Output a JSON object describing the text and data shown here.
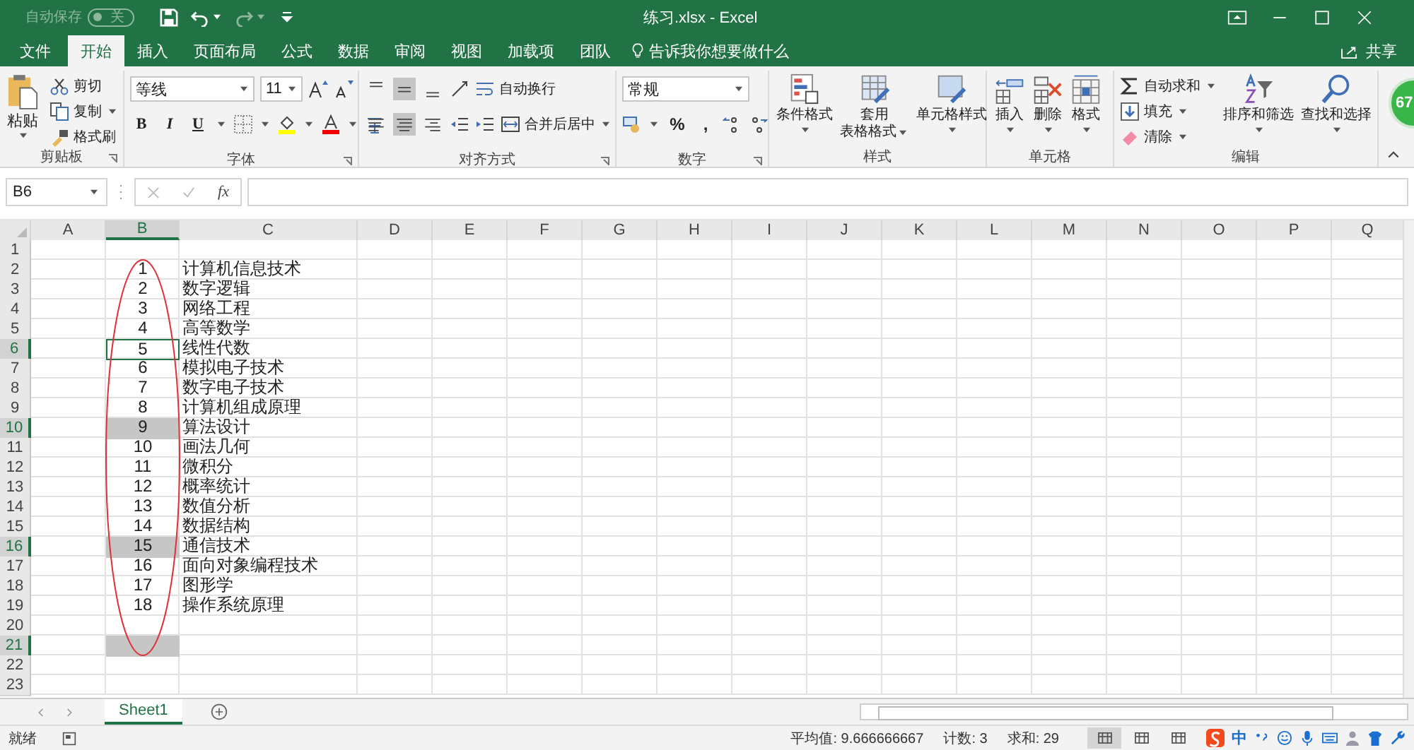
{
  "title_bar": {
    "autosave": "自动保存",
    "autosave_toggle": {
      "label": "关",
      "on": false
    },
    "title": "练习.xlsx - Excel"
  },
  "tabs": [
    {
      "label": "文件",
      "selected": false
    },
    {
      "label": "开始",
      "selected": true
    },
    {
      "label": "插入",
      "selected": false
    },
    {
      "label": "页面布局",
      "selected": false
    },
    {
      "label": "公式",
      "selected": false
    },
    {
      "label": "数据",
      "selected": false
    },
    {
      "label": "审阅",
      "selected": false
    },
    {
      "label": "视图",
      "selected": false
    },
    {
      "label": "加载项",
      "selected": false
    },
    {
      "label": "团队",
      "selected": false
    }
  ],
  "tell_me": "告诉我你想要做什么",
  "share": "共享",
  "ribbon": {
    "clipboard": {
      "label": "剪贴板",
      "paste": "粘贴",
      "items": [
        {
          "kind": "cut",
          "label": "剪切"
        },
        {
          "kind": "copy",
          "label": "复制"
        },
        {
          "kind": "painter",
          "label": "格式刷"
        }
      ]
    },
    "font": {
      "label": "字体",
      "font": "等线",
      "size": "11",
      "styles": [
        "B",
        "I",
        "U"
      ]
    },
    "alignment": {
      "label": "对齐方式",
      "vertical": [
        {
          "selected": false
        },
        {
          "selected": true
        },
        {
          "selected": false
        }
      ],
      "horizontal": [
        {
          "selected": false
        },
        {
          "selected": true
        },
        {
          "selected": false
        }
      ],
      "wrap": "自动换行",
      "merge": "合并后居中"
    },
    "number": {
      "label": "数字",
      "format": "常规",
      "percent": "%",
      "comma": ","
    },
    "styles": {
      "label": "样式",
      "buttons": [
        {
          "kind": "conditional",
          "label": "条件格式"
        },
        {
          "kind": "table",
          "label": "套用",
          "label2": "表格格式"
        },
        {
          "kind": "cell_style",
          "label": "单元格样式"
        }
      ]
    },
    "cells": {
      "label": "单元格",
      "buttons": [
        {
          "kind": "insert",
          "label": "插入"
        },
        {
          "kind": "delete",
          "label": "删除"
        },
        {
          "kind": "format",
          "label": "格式"
        }
      ]
    },
    "editing": {
      "label": "编辑",
      "items": [
        {
          "kind": "autosum",
          "label": "自动求和"
        },
        {
          "kind": "fill",
          "label": "填充"
        },
        {
          "kind": "clear",
          "label": "清除"
        }
      ],
      "buttons": [
        {
          "kind": "sort",
          "label": "排序和筛选"
        },
        {
          "kind": "find",
          "label": "查找和选择"
        }
      ]
    }
  },
  "badge": "67",
  "formula_bar": {
    "name_box": "B6",
    "fx": "fx"
  },
  "sheet": {
    "columns": [
      {
        "header": "A",
        "selected": false
      },
      {
        "header": "B",
        "selected": true
      },
      {
        "header": "C",
        "selected": false
      },
      {
        "header": "D",
        "selected": false
      },
      {
        "header": "E",
        "selected": false
      },
      {
        "header": "F",
        "selected": false
      },
      {
        "header": "G",
        "selected": false
      },
      {
        "header": "H",
        "selected": false
      },
      {
        "header": "I",
        "selected": false
      },
      {
        "header": "J",
        "selected": false
      },
      {
        "header": "K",
        "selected": false
      },
      {
        "header": "L",
        "selected": false
      },
      {
        "header": "M",
        "selected": false
      },
      {
        "header": "N",
        "selected": false
      },
      {
        "header": "O",
        "selected": false
      },
      {
        "header": "P",
        "selected": false
      },
      {
        "header": "Q",
        "selected": false
      }
    ],
    "rows": [
      {
        "header": "1",
        "selected": false,
        "active": false
      },
      {
        "header": "2",
        "selected": false,
        "active": false,
        "b": "1",
        "c": "计算机信息技术"
      },
      {
        "header": "3",
        "selected": false,
        "active": false,
        "b": "2",
        "c": "数字逻辑"
      },
      {
        "header": "4",
        "selected": false,
        "active": false,
        "b": "3",
        "c": "网络工程"
      },
      {
        "header": "5",
        "selected": false,
        "active": false,
        "b": "4",
        "c": "高等数学"
      },
      {
        "header": "6",
        "selected": true,
        "active": true,
        "b": "5",
        "c": "线性代数"
      },
      {
        "header": "7",
        "selected": false,
        "active": false,
        "b": "6",
        "c": "模拟电子技术"
      },
      {
        "header": "8",
        "selected": false,
        "active": false,
        "b": "7",
        "c": "数字电子技术"
      },
      {
        "header": "9",
        "selected": false,
        "active": false,
        "b": "8",
        "c": "计算机组成原理"
      },
      {
        "header": "10",
        "selected": true,
        "active": false,
        "b": "9",
        "c": "算法设计"
      },
      {
        "header": "11",
        "selected": false,
        "active": false,
        "b": "10",
        "c": "画法几何"
      },
      {
        "header": "12",
        "selected": false,
        "active": false,
        "b": "11",
        "c": "微积分"
      },
      {
        "header": "13",
        "selected": false,
        "active": false,
        "b": "12",
        "c": "概率统计"
      },
      {
        "header": "14",
        "selected": false,
        "active": false,
        "b": "13",
        "c": "数值分析"
      },
      {
        "header": "15",
        "selected": false,
        "active": false,
        "b": "14",
        "c": "数据结构"
      },
      {
        "header": "16",
        "selected": true,
        "active": false,
        "b": "15",
        "c": "通信技术"
      },
      {
        "header": "17",
        "selected": false,
        "active": false,
        "b": "16",
        "c": "面向对象编程技术"
      },
      {
        "header": "18",
        "selected": false,
        "active": false,
        "b": "17",
        "c": "图形学"
      },
      {
        "header": "19",
        "selected": false,
        "active": false,
        "b": "18",
        "c": "操作系统原理"
      },
      {
        "header": "20",
        "selected": false,
        "active": false
      },
      {
        "header": "21",
        "selected": true,
        "active": false
      },
      {
        "header": "22",
        "selected": false,
        "active": false
      },
      {
        "header": "23",
        "selected": false,
        "active": false
      }
    ]
  },
  "sheet_tabs": [
    {
      "label": "Sheet1",
      "selected": true
    }
  ],
  "status_bar": {
    "ready": "就绪",
    "average": "平均值: 9.666666667",
    "count": "计数: 3",
    "sum": "求和: 29",
    "views": [
      {
        "selected": true
      },
      {
        "selected": false
      },
      {
        "selected": false
      }
    ],
    "ime": "中"
  }
}
